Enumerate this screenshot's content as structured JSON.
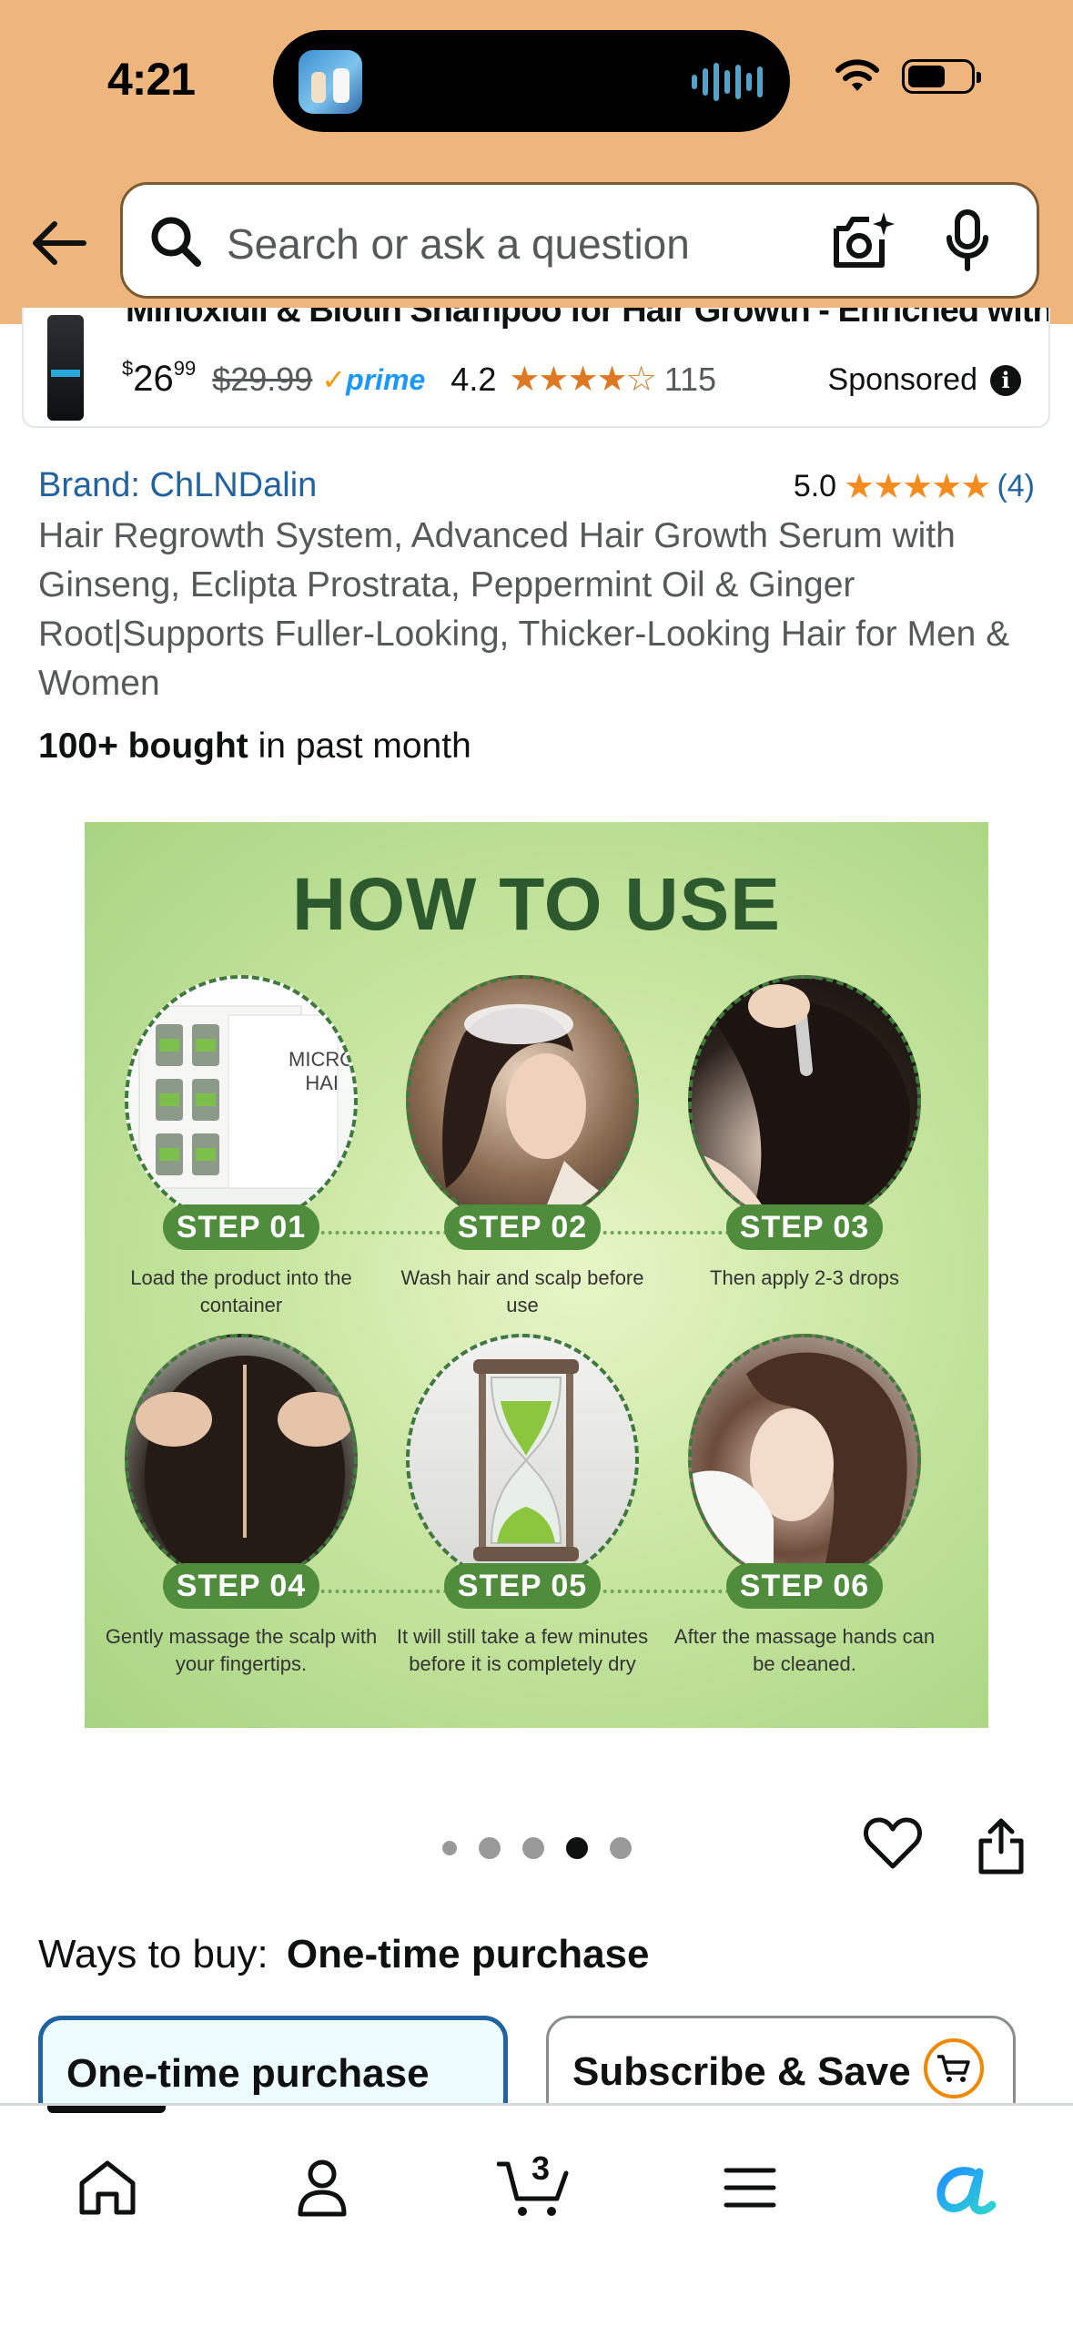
{
  "status_bar": {
    "time": "4:21"
  },
  "search": {
    "placeholder": "Search or ask a question"
  },
  "sponsored": {
    "title": "Minoxidil & Biotin Shampoo for Hair Growth - Enriched with...",
    "price_symbol": "$",
    "price_whole": "26",
    "price_fraction": "99",
    "price_old": "$29.99",
    "prime_label": "prime",
    "rating": "4.2",
    "stars": "★★★★☆",
    "review_count": "115",
    "label": "Sponsored"
  },
  "product": {
    "brand": "Brand: ChLNDalin",
    "rating": "5.0",
    "stars": "★★★★★",
    "rating_count": "(4)",
    "title": "Hair Regrowth System, Advanced Hair Growth Serum with Ginseng, Eclipta Prostrata, Peppermint Oil & Ginger Root|Supports Fuller-Looking, Thicker-Looking Hair for Men & Women",
    "bought_bold": "100+ bought",
    "bought_rest": " in past month"
  },
  "image": {
    "heading": "HOW TO USE",
    "steps": [
      {
        "label": "STEP 01",
        "desc": "Load the product into the container",
        "box_text": "MICRO\nHAI"
      },
      {
        "label": "STEP 02",
        "desc": "Wash hair and scalp before use"
      },
      {
        "label": "STEP 03",
        "desc": "Then apply 2-3 drops"
      },
      {
        "label": "STEP 04",
        "desc": "Gently massage the scalp with your fingertips."
      },
      {
        "label": "STEP 05",
        "desc": "It will still take a few minutes before it is completely dry"
      },
      {
        "label": "STEP 06",
        "desc": "After the massage hands can be cleaned."
      }
    ],
    "carousel": {
      "total": 5,
      "active_index": 3
    }
  },
  "ways_to_buy": {
    "label": "Ways to buy:",
    "selected": "One-time purchase",
    "options": [
      "One-time purchase",
      "Subscribe & Save"
    ]
  },
  "bottom_nav": {
    "items": [
      "home-icon",
      "account-icon",
      "cart-icon",
      "menu-icon",
      "rufus-icon"
    ],
    "cart_count": "3"
  },
  "colors": {
    "header": "#eeb67c",
    "link": "#2162a1",
    "star": "#de7921",
    "prime": "#1a98ff",
    "step_pill": "#4f8d3d"
  }
}
